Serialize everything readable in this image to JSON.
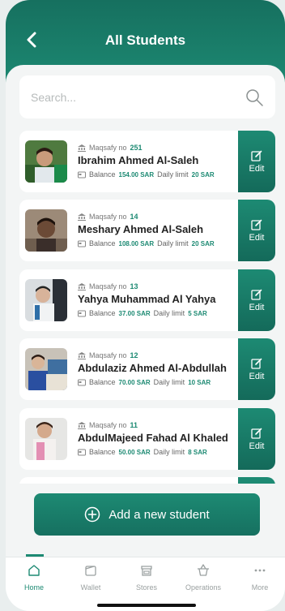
{
  "header": {
    "title": "All Students",
    "back_icon": "chevron-left-icon"
  },
  "search": {
    "placeholder": "Search..."
  },
  "students": [
    {
      "maqsafy_label": "Maqsafy no",
      "maqsafy_no": "251",
      "name": "Ibrahim Ahmed Al-Saleh",
      "balance_label": "Balance",
      "balance": "154.00 SAR",
      "limit_label": "Daily limit",
      "limit": "20 SAR",
      "edit_label": "Edit"
    },
    {
      "maqsafy_label": "Maqsafy no",
      "maqsafy_no": "14",
      "name": "Meshary Ahmed Al-Saleh",
      "balance_label": "Balance",
      "balance": "108.00 SAR",
      "limit_label": "Daily limit",
      "limit": "20 SAR",
      "edit_label": "Edit"
    },
    {
      "maqsafy_label": "Maqsafy no",
      "maqsafy_no": "13",
      "name": "Yahya Muhammad Al Yahya",
      "balance_label": "Balance",
      "balance": "37.00 SAR",
      "limit_label": "Daily limit",
      "limit": "5 SAR",
      "edit_label": "Edit"
    },
    {
      "maqsafy_label": "Maqsafy no",
      "maqsafy_no": "12",
      "name": "Abdulaziz Ahmed Al-Abdullah",
      "balance_label": "Balance",
      "balance": "70.00 SAR",
      "limit_label": "Daily limit",
      "limit": "10 SAR",
      "edit_label": "Edit"
    },
    {
      "maqsafy_label": "Maqsafy no",
      "maqsafy_no": "11",
      "name": "AbdulMajeed Fahad Al Khaled",
      "balance_label": "Balance",
      "balance": "50.00 SAR",
      "limit_label": "Daily limit",
      "limit": "8 SAR",
      "edit_label": "Edit"
    }
  ],
  "add_button": {
    "label": "Add a new student"
  },
  "tabs": [
    {
      "label": "Home",
      "icon": "home-icon",
      "active": true
    },
    {
      "label": "Wallet",
      "icon": "wallet-icon",
      "active": false
    },
    {
      "label": "Stores",
      "icon": "store-icon",
      "active": false
    },
    {
      "label": "Operations",
      "icon": "basket-icon",
      "active": false
    },
    {
      "label": "More",
      "icon": "more-icon",
      "active": false
    }
  ],
  "colors": {
    "brand": "#1d8a73",
    "brand_dark": "#146a5a"
  }
}
